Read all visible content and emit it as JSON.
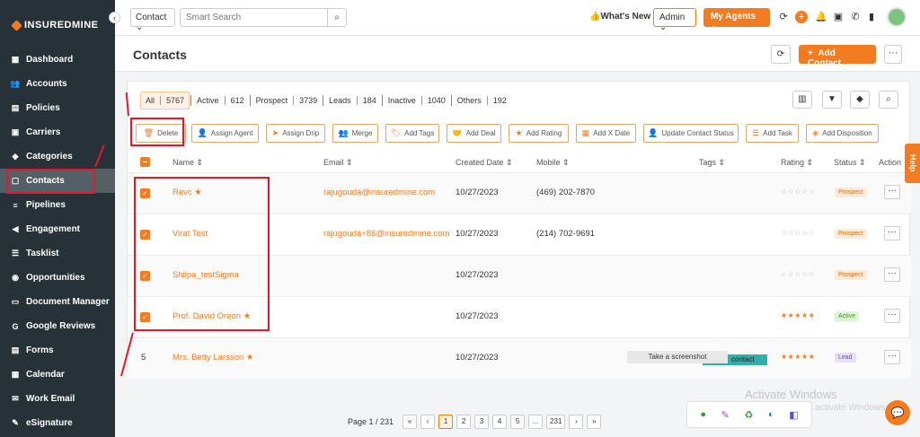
{
  "brand": {
    "name": "INSUREDMINE"
  },
  "sidebar": {
    "items": [
      {
        "label": "Dashboard",
        "icon": "dashboard-icon",
        "glyph": "▦"
      },
      {
        "label": "Accounts",
        "icon": "accounts-icon",
        "glyph": "👥"
      },
      {
        "label": "Policies",
        "icon": "policies-icon",
        "glyph": "▤"
      },
      {
        "label": "Carriers",
        "icon": "carriers-icon",
        "glyph": "▣"
      },
      {
        "label": "Categories",
        "icon": "categories-icon",
        "glyph": "◆"
      },
      {
        "label": "Contacts",
        "icon": "contacts-icon",
        "glyph": "▢",
        "active": true
      },
      {
        "label": "Pipelines",
        "icon": "pipelines-icon",
        "glyph": "≡"
      },
      {
        "label": "Engagement",
        "icon": "engagement-icon",
        "glyph": "◀"
      },
      {
        "label": "Tasklist",
        "icon": "tasklist-icon",
        "glyph": "☰"
      },
      {
        "label": "Opportunities",
        "icon": "opportunities-icon",
        "glyph": "◉"
      },
      {
        "label": "Document Manager",
        "icon": "folder-icon",
        "glyph": "▭"
      },
      {
        "label": "Google Reviews",
        "icon": "google-icon",
        "glyph": "G"
      },
      {
        "label": "Forms",
        "icon": "forms-icon",
        "glyph": "▤"
      },
      {
        "label": "Calendar",
        "icon": "calendar-icon",
        "glyph": "▦"
      },
      {
        "label": "Work Email",
        "icon": "email-icon",
        "glyph": "✉"
      },
      {
        "label": "eSignature",
        "icon": "signature-icon",
        "glyph": "✎"
      }
    ]
  },
  "topbar": {
    "search_type": "Contact",
    "search_placeholder": "Smart Search",
    "whats_new": "What's New",
    "role": "Admin",
    "my_agents": "My Agents"
  },
  "header": {
    "title": "Contacts",
    "add_contact": "Add Contact"
  },
  "filters": [
    {
      "label": "All",
      "count": "5767",
      "active": true
    },
    {
      "label": "Active",
      "count": "612"
    },
    {
      "label": "Prospect",
      "count": "3739"
    },
    {
      "label": "Leads",
      "count": "184"
    },
    {
      "label": "Inactive",
      "count": "1040"
    },
    {
      "label": "Others",
      "count": "192"
    }
  ],
  "actions": [
    {
      "label": "Delete",
      "icon": "trash-icon",
      "glyph": "🗑"
    },
    {
      "label": "Assign Agent",
      "icon": "assign-agent-icon",
      "glyph": "👤"
    },
    {
      "label": "Assign Drip",
      "icon": "drip-icon",
      "glyph": "➤"
    },
    {
      "label": "Merge",
      "icon": "merge-icon",
      "glyph": "👥"
    },
    {
      "label": "Add Tags",
      "icon": "tag-icon",
      "glyph": "🏷"
    },
    {
      "label": "Add Deal",
      "icon": "deal-icon",
      "glyph": "🤝"
    },
    {
      "label": "Add Rating",
      "icon": "star-icon",
      "glyph": "★"
    },
    {
      "label": "Add X Date",
      "icon": "calendar-icon",
      "glyph": "▦"
    },
    {
      "label": "Update Contact Status",
      "icon": "status-icon",
      "glyph": "👤"
    },
    {
      "label": "Add Task",
      "icon": "task-icon",
      "glyph": "☰"
    },
    {
      "label": "Add Disposition",
      "icon": "disposition-icon",
      "glyph": "◈"
    }
  ],
  "columns": {
    "name": "Name",
    "email": "Email",
    "created": "Created Date",
    "mobile": "Mobile",
    "tags": "Tags",
    "rating": "Rating",
    "status": "Status",
    "action": "Action"
  },
  "rows": [
    {
      "index": "",
      "checked": true,
      "name": "Revc",
      "starred": true,
      "email": "rajugouda@insuredmine.com",
      "created": "10/27/2023",
      "mobile": "(469) 202-7870",
      "stars": "☆☆☆☆☆",
      "filled": false,
      "status": "Prospect"
    },
    {
      "index": "",
      "checked": true,
      "name": "Virat Test",
      "starred": false,
      "email": "rajugouda+86@insuredmine.com",
      "created": "10/27/2023",
      "mobile": "(214) 702-9691",
      "stars": "☆☆☆☆☆",
      "filled": false,
      "status": "Prospect"
    },
    {
      "index": "",
      "checked": true,
      "name": "Shilpa_testSigma",
      "starred": false,
      "email": "",
      "created": "10/27/2023",
      "mobile": "",
      "stars": "☆☆☆☆☆",
      "filled": false,
      "status": "Prospect"
    },
    {
      "index": "",
      "checked": true,
      "name": "Prof. David Oreon",
      "starred": true,
      "email": "",
      "created": "10/27/2023",
      "mobile": "",
      "stars": "★★★★★",
      "filled": true,
      "status": "Active"
    },
    {
      "index": "5",
      "checked": false,
      "name": "Mrs. Betty Larsson",
      "starred": true,
      "email": "",
      "created": "10/27/2023",
      "mobile": "",
      "stars": "★★★★★",
      "filled": true,
      "status": "Lead"
    }
  ],
  "pagination": {
    "label": "Page 1 / 231",
    "pages": [
      "1",
      "2",
      "3",
      "4",
      "5",
      "...",
      "231"
    ],
    "first": "«",
    "prev": "‹",
    "next": "›",
    "last": "»"
  },
  "help": "Help",
  "tooltip": "Take a screenshot",
  "ghost_tag": "contact",
  "watermark": {
    "title": "Activate Windows",
    "subtitle": "Go to Settings to activate Windows."
  },
  "colors": {
    "accent": "#f47c20",
    "sidebar": "#263238",
    "annotation": "#e0192c"
  }
}
